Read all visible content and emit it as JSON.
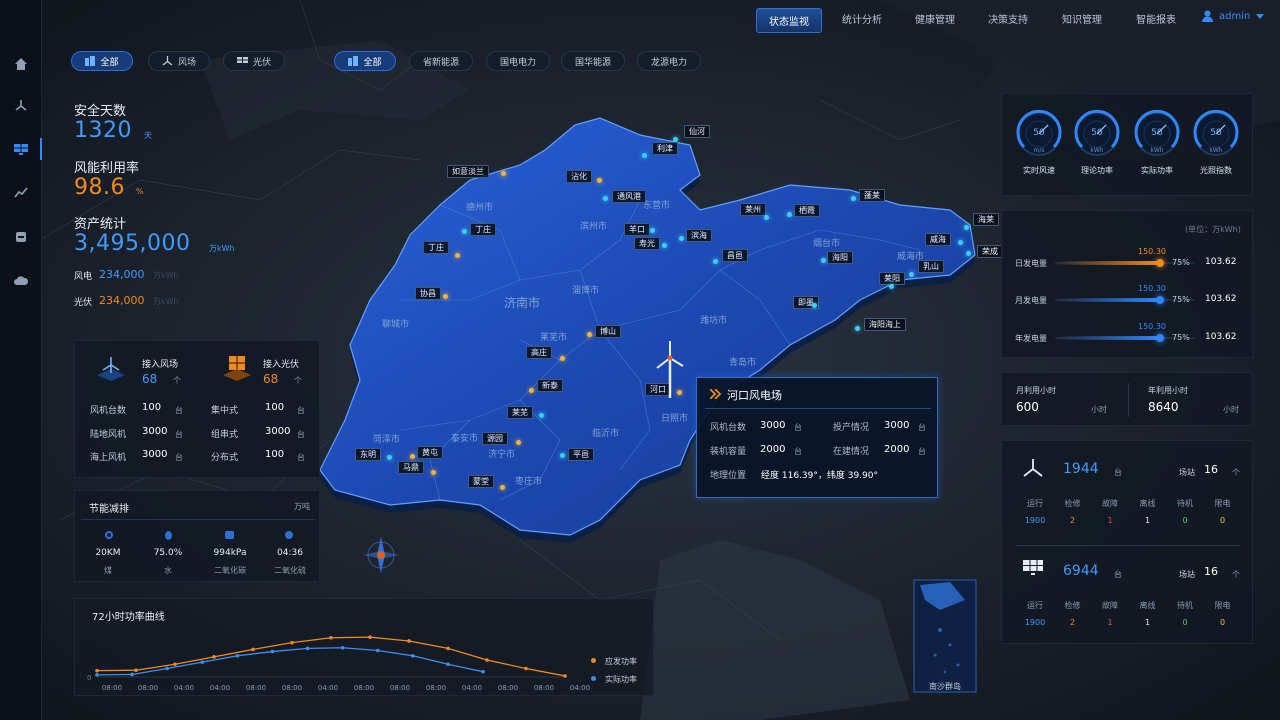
{
  "nav": {
    "items": [
      "状态监视",
      "统计分析",
      "健康管理",
      "决策支持",
      "知识管理",
      "智能报表"
    ],
    "active": 0,
    "user": "admin"
  },
  "filters": {
    "type": [
      "全部",
      "风场",
      "光伏"
    ],
    "company": [
      "全部",
      "省新能源",
      "国电电力",
      "国华能源",
      "龙源电力"
    ]
  },
  "kpi": {
    "safety_label": "安全天数",
    "safety_value": "1320",
    "safety_unit": "天",
    "wind_rate_label": "风能利用率",
    "wind_rate_value": "98.6",
    "wind_rate_unit": "%",
    "asset_label": "资产统计",
    "asset_value": "3,495,000",
    "asset_unit": "万kWh",
    "wind_label": "风电",
    "wind_value": "234,000",
    "wind_unit": "万kWh",
    "pv_label": "光伏",
    "pv_value": "234,000",
    "pv_unit": "万kWh"
  },
  "access": {
    "wind_title": "接入风场",
    "wind_count": "68",
    "wind_unit": "个",
    "pv_title": "接入光伏",
    "pv_count": "68",
    "pv_unit": "个",
    "wind_rows": [
      {
        "label": "风机台数",
        "value": "100",
        "unit": "台"
      },
      {
        "label": "陆地风机",
        "value": "3000",
        "unit": "台"
      },
      {
        "label": "海上风机",
        "value": "3000",
        "unit": "台"
      }
    ],
    "pv_rows": [
      {
        "label": "集中式",
        "value": "100",
        "unit": "台"
      },
      {
        "label": "组串式",
        "value": "3000",
        "unit": "台"
      },
      {
        "label": "分布式",
        "value": "100",
        "unit": "台"
      }
    ]
  },
  "saving": {
    "title": "节能减排",
    "unit": "万吨",
    "items": [
      {
        "value": "20KM",
        "label": "煤"
      },
      {
        "value": "75.0%",
        "label": "水"
      },
      {
        "value": "994kPa",
        "label": "二氧化碳"
      },
      {
        "value": "04:36",
        "label": "二氧化硫"
      }
    ]
  },
  "power_chart": {
    "title": "72小时功率曲线",
    "legend": [
      "应发功率",
      "实际功率"
    ]
  },
  "chart_data": {
    "type": "line",
    "title": "72小时功率曲线",
    "x": [
      "08:00",
      "08:00",
      "04:00",
      "04:00",
      "08:00",
      "08:00",
      "04:00",
      "08:00",
      "08:00",
      "08:00",
      "04:00",
      "08:00",
      "08:00",
      "04:00"
    ],
    "series": [
      {
        "name": "应发功率",
        "color": "#f08a1c",
        "values": [
          0.3,
          0.32,
          0.6,
          0.95,
          1.3,
          1.62,
          1.85,
          1.88,
          1.7,
          1.35,
          0.8,
          0.4,
          0.05
        ]
      },
      {
        "name": "实际功率",
        "color": "#3b8ff0",
        "values": [
          0.1,
          0.12,
          0.4,
          0.7,
          1.0,
          1.2,
          1.35,
          1.38,
          1.25,
          1.0,
          0.6,
          0.25
        ]
      }
    ],
    "ylim": [
      0,
      2.5
    ],
    "ytick": "0"
  },
  "map": {
    "cities": [
      "德州市",
      "聊城市",
      "济南市",
      "淄博市",
      "滨州市",
      "东营市",
      "潍坊市",
      "烟台市",
      "威海市",
      "青岛市",
      "日照市",
      "临沂市",
      "莱芜市",
      "泰安市",
      "菏泽市",
      "济宁市",
      "枣庄市"
    ],
    "stations": [
      "仙河",
      "利津",
      "如意淡兰",
      "沾化",
      "通风港",
      "丁庄",
      "羊口",
      "滨海",
      "寿光",
      "丁庄",
      "昌邑",
      "蓬莱",
      "莱州",
      "栖霞",
      "海莱",
      "威海",
      "荣成",
      "海阳",
      "乳山",
      "莱阳",
      "即墨",
      "海阳海上",
      "协昌",
      "博山",
      "高庄",
      "新泰",
      "莱芜",
      "东明",
      "黄屯",
      "源园",
      "马鼎",
      "平邑",
      "蒙堂",
      "河口"
    ]
  },
  "popup": {
    "title": "河口风电场",
    "rows": [
      {
        "label": "风机台数",
        "value": "3000",
        "unit": "台"
      },
      {
        "label": "投产情况",
        "value": "3000",
        "unit": "台"
      },
      {
        "label": "装机容量",
        "value": "2000",
        "unit": "台"
      },
      {
        "label": "在建情况",
        "value": "2000",
        "unit": "台"
      }
    ],
    "loc_label": "地理位置",
    "loc_value": "经度 116.39°，纬度 39.90°"
  },
  "gauges": [
    {
      "value": "50",
      "unit": "m/s",
      "label": "实时风速"
    },
    {
      "value": "50",
      "unit": "kWh",
      "label": "理论功率"
    },
    {
      "value": "50",
      "unit": "kWh",
      "label": "实际功率"
    },
    {
      "value": "50",
      "unit": "kWh",
      "label": "光照指数"
    }
  ],
  "generation": {
    "unit_note": "(单位：万kWh)",
    "rows": [
      {
        "label": "日发电量",
        "top": "150.30",
        "pct": "75%",
        "value": "103.62",
        "fill": 0.75,
        "color": "#f08a1c"
      },
      {
        "label": "月发电量",
        "top": "150.30",
        "pct": "75%",
        "value": "103.62",
        "fill": 0.75,
        "color": "#2f87ff"
      },
      {
        "label": "年发电量",
        "top": "150.30",
        "pct": "75%",
        "value": "103.62",
        "fill": 0.75,
        "color": "#2f87ff"
      }
    ]
  },
  "hours": {
    "month_label": "月利用小时",
    "month_value": "600",
    "year_label": "年利用小时",
    "year_value": "8640",
    "unit": "小时"
  },
  "wind_stat": {
    "count": "1944",
    "unit": "台",
    "station_label": "场站",
    "station_count": "16",
    "station_unit": "个",
    "heads": [
      "运行",
      "检修",
      "故障",
      "离线",
      "待机",
      "限电"
    ],
    "values": [
      "1900",
      "2",
      "1",
      "1",
      "0",
      "0"
    ]
  },
  "pv_stat": {
    "count": "6944",
    "unit": "台",
    "station_label": "场站",
    "station_count": "16",
    "station_unit": "个",
    "heads": [
      "运行",
      "检修",
      "故障",
      "离线",
      "待机",
      "限电"
    ],
    "values": [
      "1900",
      "2",
      "1",
      "1",
      "0",
      "0"
    ]
  },
  "inset": {
    "label": "南沙群岛"
  }
}
